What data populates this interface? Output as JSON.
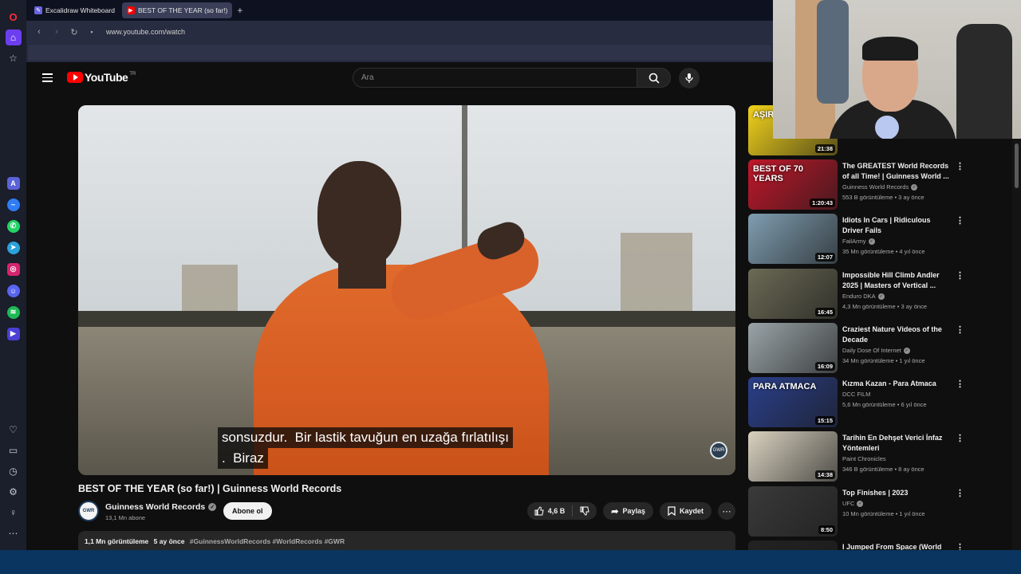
{
  "browser": {
    "tabs": [
      {
        "label": "Excalidraw Whiteboard",
        "icon": "excalidraw-icon",
        "active": false
      },
      {
        "label": "BEST OF THE YEAR (so far!)",
        "icon": "youtube-icon",
        "active": true
      }
    ],
    "url": "www.youtube.com/watch"
  },
  "header": {
    "logo_text": "YouTube",
    "logo_region": "TR",
    "search_placeholder": "Ara"
  },
  "player": {
    "subtitle_line1": "sonsuzdur.  Bir lastik tavuğun en uzağa fırlatılışı",
    "subtitle_line2": ".  Biraz",
    "watermark": "GWR"
  },
  "video": {
    "title": "BEST OF THE YEAR (so far!) | Guinness World Records",
    "channel": "Guinness World Records",
    "channel_avatar": "GWR",
    "subscribers": "13,1 Mn abone",
    "subscribe_label": "Abone ol",
    "likes": "4,6 B",
    "share_label": "Paylaş",
    "save_label": "Kaydet",
    "views": "1,1 Mn görüntüleme",
    "age": "5 ay önce",
    "tags": "#GuinnessWorldRecords #WorldRecords #GWR"
  },
  "recommendations": [
    {
      "title": "",
      "channel": "",
      "verified": false,
      "meta": "",
      "duration": "21:38",
      "thumb_text": "AŞIRI PİNT",
      "thumb_color": "#f2d21b"
    },
    {
      "title": "The GREATEST World Records of all Time! | Guinness World ...",
      "channel": "Guinness World Records",
      "verified": true,
      "meta": "553 B görüntüleme • 3 ay önce",
      "duration": "1:20:43",
      "thumb_text": "BEST OF 70 YEARS",
      "thumb_color": "#c0182a"
    },
    {
      "title": "Idiots In Cars | Ridiculous Driver Fails",
      "channel": "FailArmy",
      "verified": true,
      "meta": "35 Mn görüntüleme • 4 yıl önce",
      "duration": "12:07",
      "thumb_text": "",
      "thumb_color": "#7f9db0"
    },
    {
      "title": "Impossible Hill Climb Andler 2025 | Masters of Vertical ...",
      "channel": "Enduro DKA",
      "verified": true,
      "meta": "4,3 Mn görüntüleme • 3 ay önce",
      "duration": "16:45",
      "thumb_text": "",
      "thumb_color": "#6b6a55"
    },
    {
      "title": "Craziest Nature Videos of the Decade",
      "channel": "Daily Dose Of Internet",
      "verified": true,
      "meta": "34 Mn görüntüleme • 1 yıl önce",
      "duration": "16:09",
      "thumb_text": "",
      "thumb_color": "#9aa4a8"
    },
    {
      "title": "Kızma Kazan - Para Atmaca",
      "channel": "DCC FILM",
      "verified": false,
      "meta": "5,6 Mn görüntüleme • 6 yıl önce",
      "duration": "15:15",
      "thumb_text": "PARA ATMACA",
      "thumb_color": "#2a3f8a"
    },
    {
      "title": "Tarihin En Dehşet Verici İnfaz Yöntemleri",
      "channel": "Paint Chronicles",
      "verified": false,
      "meta": "346 B görüntüleme • 8 ay önce",
      "duration": "14:38",
      "thumb_text": "",
      "thumb_color": "#d9d2c0"
    },
    {
      "title": "Top Finishes | 2023",
      "channel": "UFC",
      "verified": true,
      "meta": "10 Mn görüntüleme • 1 yıl önce",
      "duration": "8:50",
      "thumb_text": "",
      "thumb_color": "#3a3a3a"
    },
    {
      "title": "I Jumped From Space (World",
      "channel": "",
      "verified": false,
      "meta": "",
      "duration": "",
      "thumb_text": "",
      "thumb_color": "#222222"
    }
  ],
  "colors": {
    "youtube_red": "#ff0000",
    "background": "#0f0f0f",
    "browser_sidebar": "#1b1e2b",
    "taskbar": "#0a3560"
  }
}
